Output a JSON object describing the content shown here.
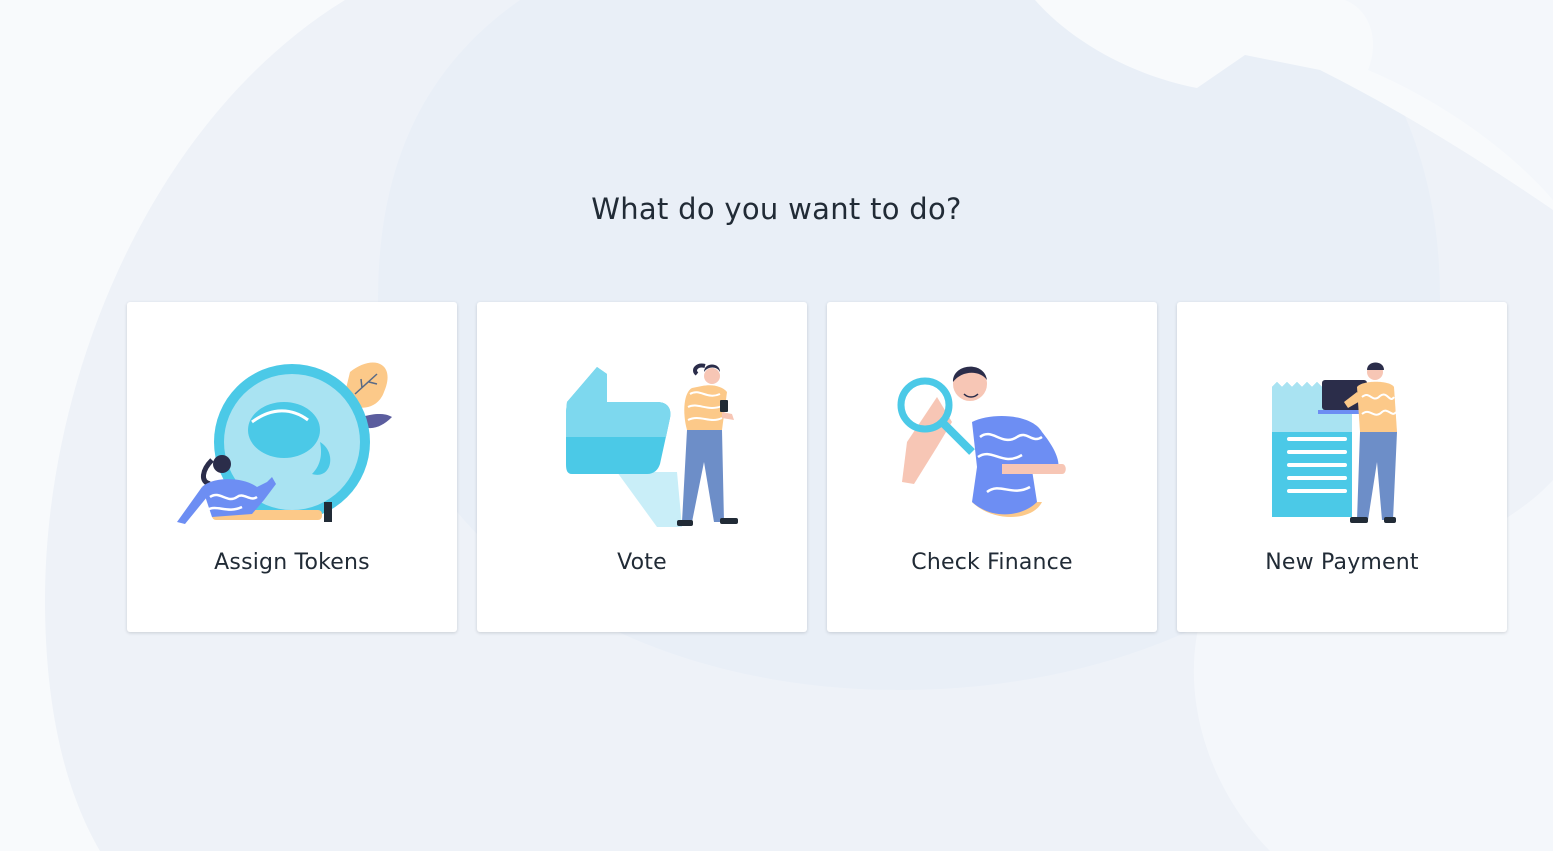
{
  "heading": "What do you want to do?",
  "actions": [
    {
      "label": "Assign Tokens",
      "icon": "assign-tokens-illustration"
    },
    {
      "label": "Vote",
      "icon": "vote-illustration"
    },
    {
      "label": "Check Finance",
      "icon": "check-finance-illustration"
    },
    {
      "label": "New Payment",
      "icon": "new-payment-illustration"
    }
  ],
  "colors": {
    "background": "#f8fafc",
    "background_shape": "#e9eff7",
    "card": "#ffffff",
    "accent_cyan": "#4bc9e7",
    "accent_blue": "#6d8ef3",
    "accent_yellow": "#fcc989",
    "text": "#212b36"
  }
}
